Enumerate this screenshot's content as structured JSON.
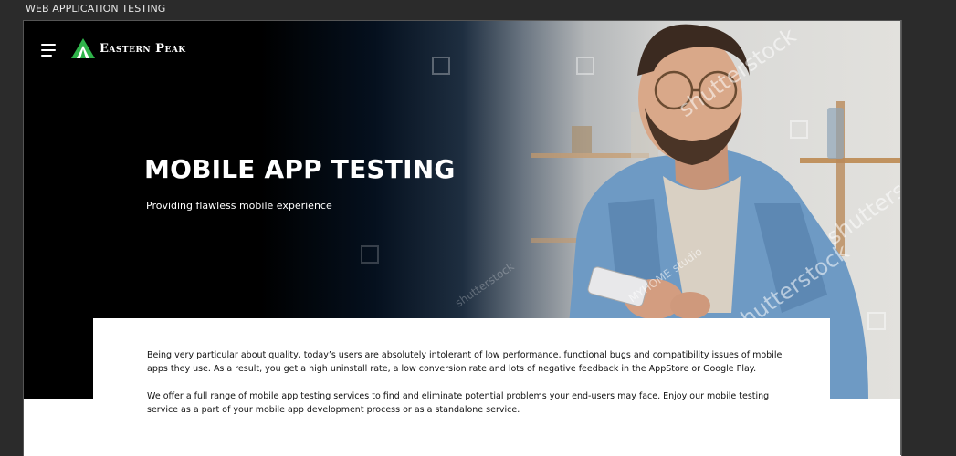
{
  "window": {
    "title": "WEB APPLICATION TESTING"
  },
  "header": {
    "brand": "Eastern Peak",
    "menu_icon": "hamburger-menu-icon",
    "logo_icon": "mountain-peak-logo"
  },
  "hero": {
    "title": "MOBILE APP TESTING",
    "subtitle": "Providing flawless mobile experience",
    "watermarks": [
      "shutterstock",
      "shutterstock",
      "shutterstock",
      "shutterstock",
      "MYHOME studio"
    ]
  },
  "content": {
    "paragraphs": [
      "Being very particular about quality, today’s users are absolutely intolerant of low performance, functional bugs and compatibility issues of mobile apps they use. As a result, you get a high uninstall rate, a low conversion rate and lots of negative feedback in the AppStore or Google Play.",
      "We offer a full range of mobile app testing services to find and eliminate potential problems your end-users may face. Enjoy our mobile testing service as a part of your mobile app development process or as a standalone service."
    ]
  },
  "colors": {
    "brand_green": "#2fb34a",
    "hero_dark": "#000000",
    "shirt_denim": "#6e9ac4",
    "text": "#111111"
  }
}
